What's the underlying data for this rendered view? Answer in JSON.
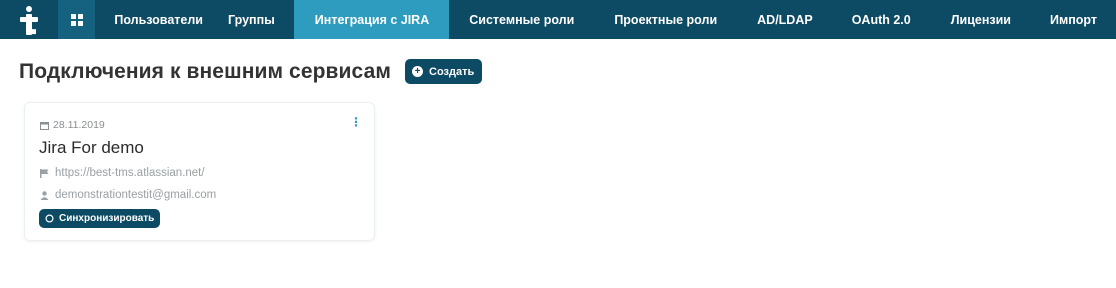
{
  "header": {
    "logo_glyph": "t",
    "apps_icon": "grid-icon",
    "nav": [
      {
        "label": "Пользователи",
        "active": false
      },
      {
        "label": "Группы",
        "active": false
      },
      {
        "label": "Интеграция с JIRA",
        "active": true
      },
      {
        "label": "Системные роли",
        "active": false
      },
      {
        "label": "Проектные роли",
        "active": false
      },
      {
        "label": "AD/LDAP",
        "active": false
      },
      {
        "label": "OAuth 2.0",
        "active": false
      },
      {
        "label": "Лицензии",
        "active": false
      },
      {
        "label": "Импорт",
        "active": false
      }
    ]
  },
  "page": {
    "title": "Подключения к внешним сервисам",
    "create_label": "Создать"
  },
  "card": {
    "date": "28.11.2019",
    "title": "Jira For demo",
    "url": "https://best-tms.atlassian.net/",
    "user": "demonstrationtestit@gmail.com",
    "sync_label": "Синхронизировать"
  },
  "colors": {
    "primary": "#0d4a64",
    "active_tab": "#2e9cbf",
    "apps_bg": "#14627f"
  }
}
